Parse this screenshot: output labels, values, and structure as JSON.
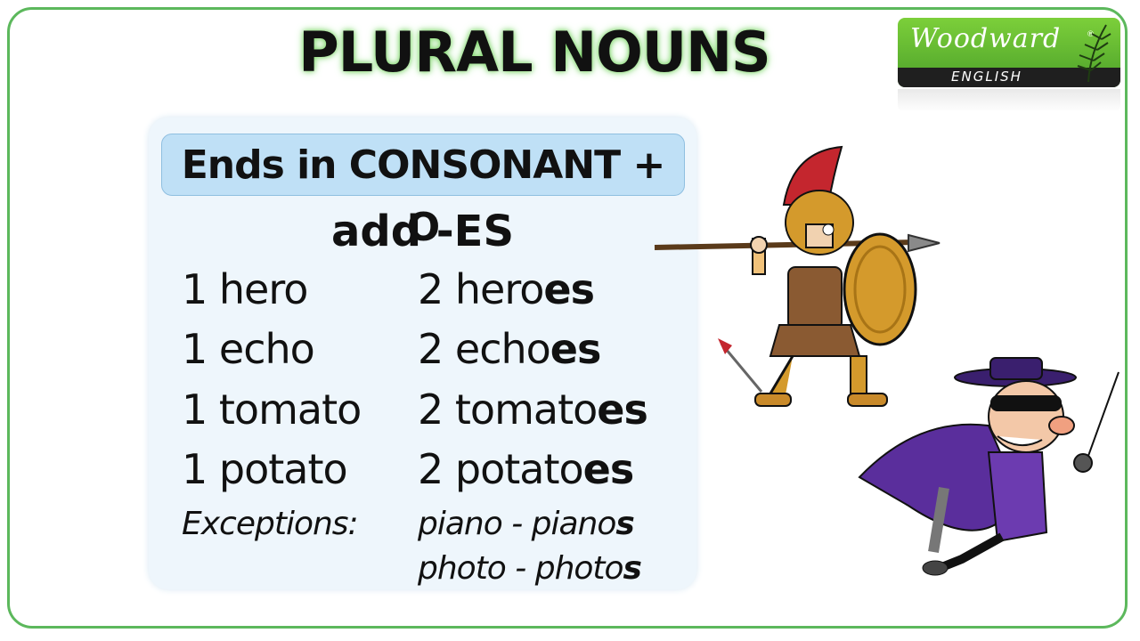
{
  "title": "PLURAL NOUNS",
  "logo": {
    "brand": "Woodward",
    "registered": "®",
    "sub": "ENGLISH",
    "colors": {
      "green": "#5cb85c",
      "dark": "#1f1f1f"
    }
  },
  "panel": {
    "header": "Ends in CONSONANT + O",
    "rule": "add -ES",
    "rows": [
      {
        "singular": "1 hero",
        "plural_stem": "2 hero",
        "plural_suffix": "es"
      },
      {
        "singular": "1 echo",
        "plural_stem": "2 echo",
        "plural_suffix": "es"
      },
      {
        "singular": "1 tomato",
        "plural_stem": "2 tomato",
        "plural_suffix": "es"
      },
      {
        "singular": "1 potato",
        "plural_stem": "2 potato",
        "plural_suffix": "es"
      }
    ],
    "exceptions_label": "Exceptions:",
    "exceptions": [
      {
        "stem": "piano - piano",
        "suffix": "s"
      },
      {
        "stem": "photo - photo",
        "suffix": "s"
      }
    ]
  },
  "illustrations": [
    "spartan-hero-icon",
    "masked-villain-icon"
  ],
  "colors": {
    "frame": "#5cb85c",
    "panel": "#eef6fc",
    "header": "#bfe0f6"
  }
}
